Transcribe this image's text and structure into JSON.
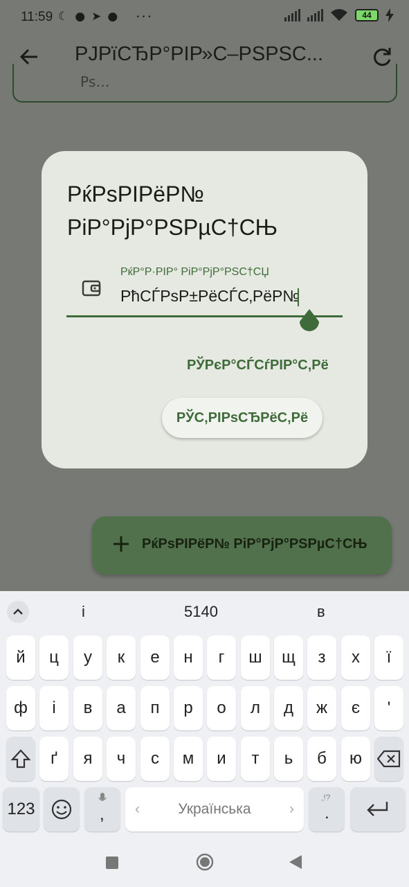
{
  "status_bar": {
    "time": "11:59",
    "battery": "44",
    "icons": [
      "moon-icon",
      "facebook-icon",
      "telegram-icon",
      "messenger-icon",
      "more-dots",
      "signal-icon",
      "signal-icon",
      "wifi-icon",
      "battery-icon",
      "charging-icon"
    ],
    "dots": "···"
  },
  "app_bar": {
    "title": "РЈРїСЂР°РІР»С–РЅРЅС...",
    "back_icon": "arrow-left-icon",
    "refresh_icon": "refresh-icon"
  },
  "background": {
    "field_text": "Рѕ…"
  },
  "dialog": {
    "title": "РќРѕРІРёР№ РіР°РјР°РЅРµС†СЊ",
    "field_label": "РќР°Р·РІР° РіР°РјР°РЅС†СЏ",
    "field_value": "РћСЃРѕР±РёСЃС‚РёР№",
    "field_icon": "wallet-icon",
    "cancel_label": "РЎРєР°СЃСѓРІР°С‚Рё",
    "create_label": "РЎС‚РІРѕСЂРёС‚Рё"
  },
  "fab": {
    "label": "РќРѕРІРёР№ РіР°РјР°РЅРµС†СЊ",
    "icon": "plus-icon"
  },
  "keyboard": {
    "suggestions": [
      "і",
      "5140",
      "в"
    ],
    "row1": [
      "й",
      "ц",
      "у",
      "к",
      "е",
      "н",
      "г",
      "ш",
      "щ",
      "з",
      "х",
      "ї"
    ],
    "row2": [
      "ф",
      "і",
      "в",
      "а",
      "п",
      "р",
      "о",
      "л",
      "д",
      "ж",
      "є",
      "'"
    ],
    "row3": [
      "ґ",
      "я",
      "ч",
      "с",
      "м",
      "и",
      "т",
      "ь",
      "б",
      "ю"
    ],
    "numbers_key": "123",
    "space_label": "Українська",
    "comma_key": ",",
    "period_key": ".",
    "punct_hint": ",!?"
  },
  "colors": {
    "accent": "#3f6b3a",
    "scrim": "#777a74",
    "dialog_bg": "#e5e9e1",
    "fab_bg": "#51704c",
    "battery_fill": "#7dd86a"
  }
}
